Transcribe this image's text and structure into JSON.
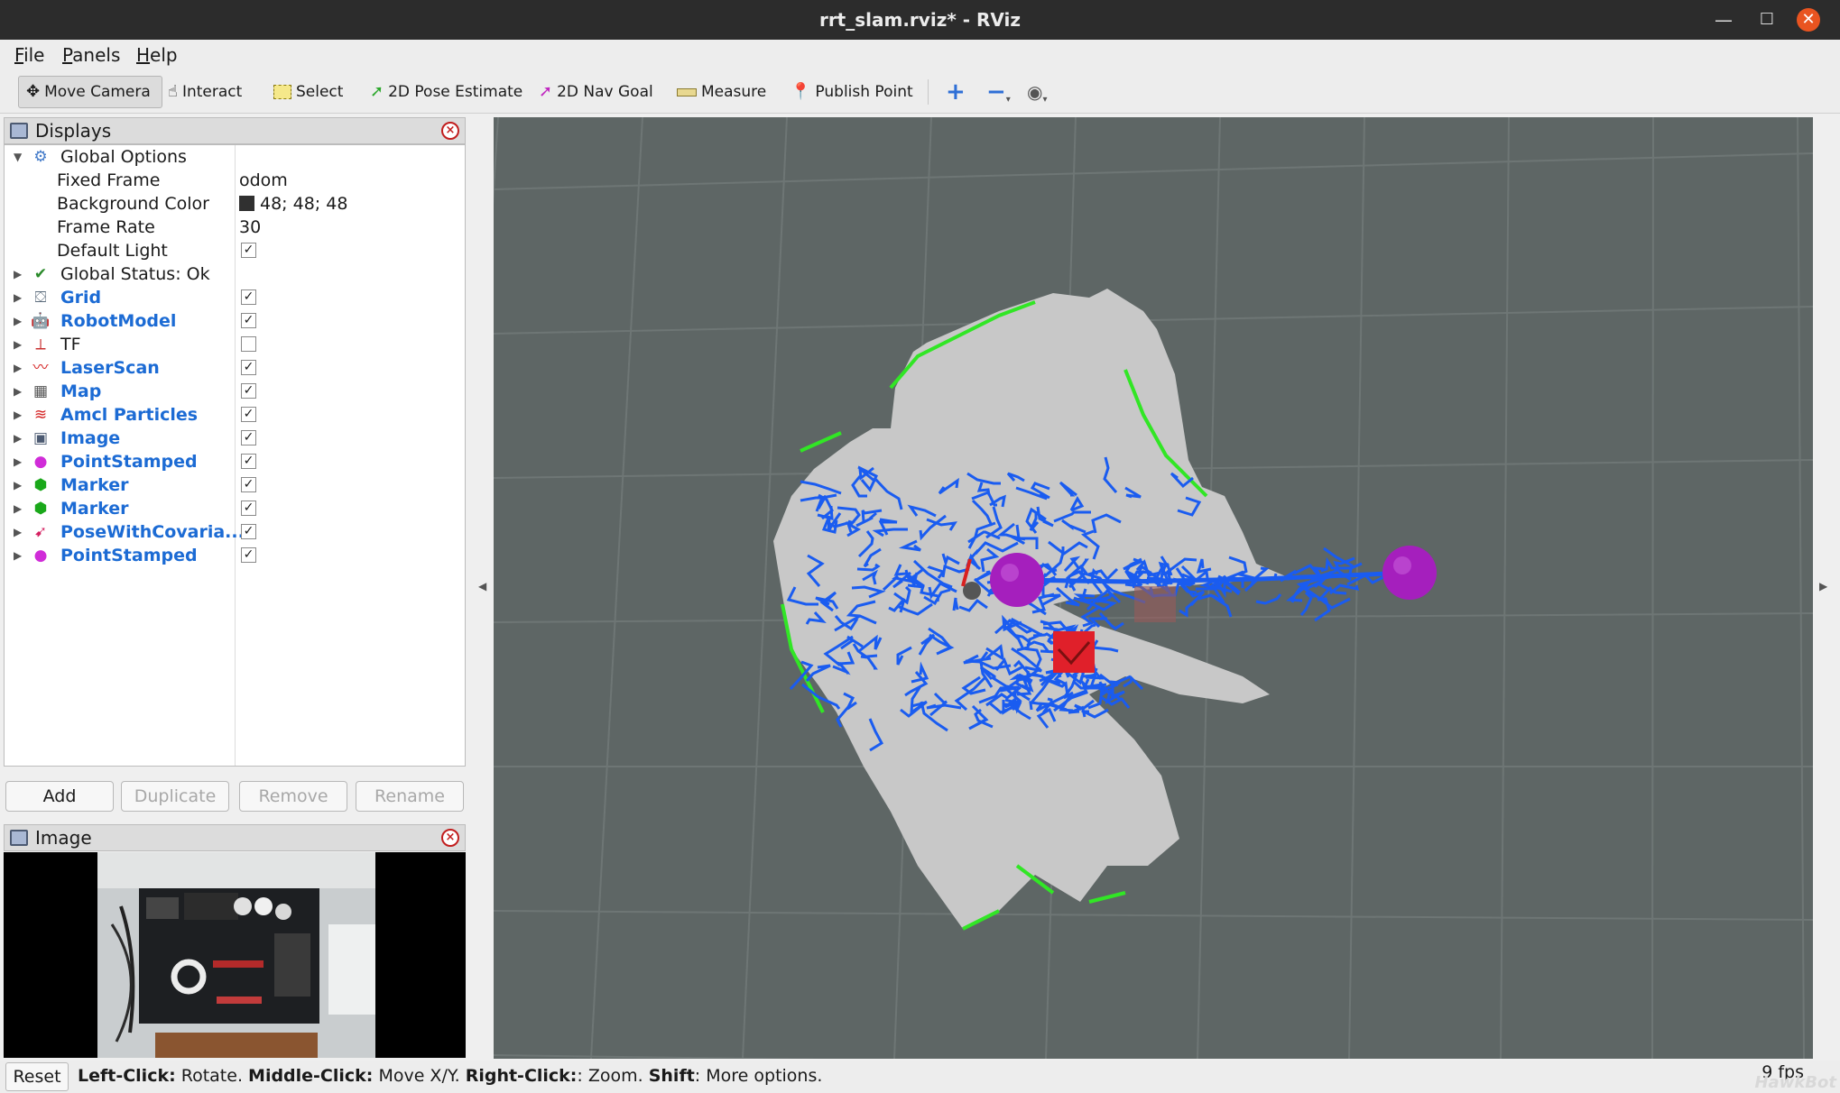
{
  "window": {
    "title": "rrt_slam.rviz* - RViz",
    "minimize_glyph": "—",
    "maximize_glyph": "☐",
    "close_glyph": "✕"
  },
  "menus": [
    {
      "label": "File",
      "accel": "F",
      "rest": "ile"
    },
    {
      "label": "Panels",
      "accel": "P",
      "rest": "anels"
    },
    {
      "label": "Help",
      "accel": "H",
      "rest": "elp"
    }
  ],
  "toolbar": {
    "move_camera": "Move Camera",
    "interact": "Interact",
    "select": "Select",
    "pose_estimate": "2D Pose Estimate",
    "nav_goal": "2D Nav Goal",
    "measure": "Measure",
    "publish_point": "Publish Point",
    "zoom_in_glyph": "+",
    "zoom_out_glyph": "−",
    "view_glyph": "◉"
  },
  "displays_panel": {
    "title": "Displays",
    "close_glyph": "×",
    "global_options": {
      "label": "Global Options",
      "fixed_frame_label": "Fixed Frame",
      "fixed_frame_value": "odom",
      "background_color_label": "Background Color",
      "background_color_value": "48; 48; 48",
      "frame_rate_label": "Frame Rate",
      "frame_rate_value": "30",
      "default_light_label": "Default Light",
      "default_light_checked": true
    },
    "global_status": "Global Status: Ok",
    "items": [
      {
        "name": "Grid",
        "checked": true,
        "icon": "grid-icon"
      },
      {
        "name": "RobotModel",
        "checked": true,
        "icon": "robot-icon"
      },
      {
        "name": "TF",
        "checked": false,
        "icon": "tf-axes-icon"
      },
      {
        "name": "LaserScan",
        "checked": true,
        "icon": "laserscan-icon"
      },
      {
        "name": "Map",
        "checked": true,
        "icon": "map-icon"
      },
      {
        "name": "Amcl Particles",
        "checked": true,
        "icon": "particles-icon"
      },
      {
        "name": "Image",
        "checked": true,
        "icon": "image-icon"
      },
      {
        "name": "PointStamped",
        "checked": true,
        "icon": "point-icon"
      },
      {
        "name": "Marker",
        "checked": true,
        "icon": "marker-icon"
      },
      {
        "name": "Marker",
        "checked": true,
        "icon": "marker-icon"
      },
      {
        "name": "PoseWithCovaria...",
        "checked": true,
        "icon": "pose-icon"
      },
      {
        "name": "PointStamped",
        "checked": true,
        "icon": "point-icon"
      }
    ],
    "check_glyph": "✓",
    "buttons": {
      "add": "Add",
      "duplicate": "Duplicate",
      "remove": "Remove",
      "rename": "Rename"
    }
  },
  "image_panel": {
    "title": "Image",
    "close_glyph": "×"
  },
  "status_bar": {
    "reset": "Reset",
    "left_click": "Left-Click:",
    "left_click_action": " Rotate. ",
    "middle_click": "Middle-Click:",
    "middle_click_action": " Move X/Y. ",
    "right_click": "Right-Click:",
    "right_click_action": ": Zoom. ",
    "shift": "Shift",
    "shift_action": ": More options.",
    "fps": "9 fps",
    "watermark": "HawkBot"
  },
  "colors": {
    "grid_background": "#5e6665",
    "grid_lines": "#6e7675",
    "map_free": "#c8c8c8",
    "rrt_tree": "#1a5cf0",
    "frontier_edge": "#31e625",
    "marker_sphere": "#a51fbd",
    "robot_marker": "#e0202a"
  }
}
